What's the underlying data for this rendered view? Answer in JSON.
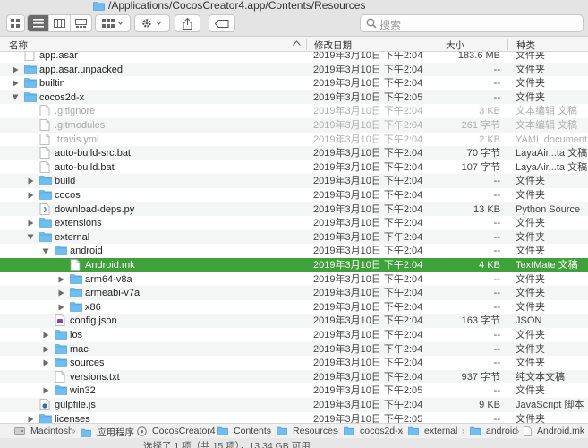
{
  "window": {
    "title": "/Applications/CocosCreator4.app/Contents/Resources"
  },
  "search": {
    "placeholder": "搜索"
  },
  "columns": {
    "name": "名称",
    "date": "修改日期",
    "size": "大小",
    "kind": "种类"
  },
  "rows": [
    {
      "name": "app.asar",
      "date": "2019年3月10日 下午2:04",
      "size": "183.6 MB",
      "kind": "文件夹",
      "icon": "file-icon",
      "depth": 1,
      "expander": "none",
      "dim": false
    },
    {
      "name": "app.asar.unpacked",
      "date": "2019年3月10日 下午2:04",
      "size": "--",
      "kind": "文件夹",
      "icon": "folder-icon",
      "depth": 1,
      "expander": "collapsed",
      "dim": false
    },
    {
      "name": "builtin",
      "date": "2019年3月10日 下午2:04",
      "size": "--",
      "kind": "文件夹",
      "icon": "folder-icon",
      "depth": 1,
      "expander": "collapsed",
      "dim": false
    },
    {
      "name": "cocos2d-x",
      "date": "2019年3月10日 下午2:05",
      "size": "--",
      "kind": "文件夹",
      "icon": "folder-icon",
      "depth": 1,
      "expander": "expanded",
      "dim": false
    },
    {
      "name": ".gitignore",
      "date": "2019年3月10日 下午2:04",
      "size": "3 KB",
      "kind": "文本编辑 文稿",
      "icon": "document-icon",
      "depth": 2,
      "expander": "none",
      "dim": true
    },
    {
      "name": ".gitmodules",
      "date": "2019年3月10日 下午2:04",
      "size": "261 字节",
      "kind": "文本编辑 文稿",
      "icon": "document-icon",
      "depth": 2,
      "expander": "none",
      "dim": true
    },
    {
      "name": ".travis.yml",
      "date": "2019年3月10日 下午2:04",
      "size": "2 KB",
      "kind": "YAML document",
      "icon": "document-icon",
      "depth": 2,
      "expander": "none",
      "dim": true
    },
    {
      "name": "auto-build-src.bat",
      "date": "2019年3月10日 下午2:04",
      "size": "70 字节",
      "kind": "LayaAir...ta 文稿",
      "icon": "document-icon",
      "depth": 2,
      "expander": "none",
      "dim": false
    },
    {
      "name": "auto-build.bat",
      "date": "2019年3月10日 下午2:04",
      "size": "107 字节",
      "kind": "LayaAir...ta 文稿",
      "icon": "document-icon",
      "depth": 2,
      "expander": "none",
      "dim": false
    },
    {
      "name": "build",
      "date": "2019年3月10日 下午2:04",
      "size": "--",
      "kind": "文件夹",
      "icon": "folder-icon",
      "depth": 2,
      "expander": "collapsed",
      "dim": false
    },
    {
      "name": "cocos",
      "date": "2019年3月10日 下午2:04",
      "size": "--",
      "kind": "文件夹",
      "icon": "folder-icon",
      "depth": 2,
      "expander": "collapsed",
      "dim": false
    },
    {
      "name": "download-deps.py",
      "date": "2019年3月10日 下午2:04",
      "size": "13 KB",
      "kind": "Python Source",
      "icon": "python-file-icon",
      "depth": 2,
      "expander": "none",
      "dim": false
    },
    {
      "name": "extensions",
      "date": "2019年3月10日 下午2:04",
      "size": "--",
      "kind": "文件夹",
      "icon": "folder-icon",
      "depth": 2,
      "expander": "collapsed",
      "dim": false
    },
    {
      "name": "external",
      "date": "2019年3月10日 下午2:04",
      "size": "--",
      "kind": "文件夹",
      "icon": "folder-icon",
      "depth": 2,
      "expander": "expanded",
      "dim": false
    },
    {
      "name": "android",
      "date": "2019年3月10日 下午2:04",
      "size": "--",
      "kind": "文件夹",
      "icon": "folder-icon",
      "depth": 3,
      "expander": "expanded",
      "dim": false
    },
    {
      "name": "Android.mk",
      "date": "2019年3月10日 下午2:04",
      "size": "4 KB",
      "kind": "TextMate 文稿",
      "icon": "document-icon",
      "depth": 4,
      "expander": "none",
      "dim": false,
      "selected": true
    },
    {
      "name": "arm64-v8a",
      "date": "2019年3月10日 下午2:04",
      "size": "--",
      "kind": "文件夹",
      "icon": "folder-icon",
      "depth": 4,
      "expander": "collapsed",
      "dim": false
    },
    {
      "name": "armeabi-v7a",
      "date": "2019年3月10日 下午2:04",
      "size": "--",
      "kind": "文件夹",
      "icon": "folder-icon",
      "depth": 4,
      "expander": "collapsed",
      "dim": false
    },
    {
      "name": "x86",
      "date": "2019年3月10日 下午2:04",
      "size": "--",
      "kind": "文件夹",
      "icon": "folder-icon",
      "depth": 4,
      "expander": "collapsed",
      "dim": false
    },
    {
      "name": "config.json",
      "date": "2019年3月10日 下午2:04",
      "size": "163 字节",
      "kind": "JSON",
      "icon": "json-file-icon",
      "depth": 3,
      "expander": "none",
      "dim": false
    },
    {
      "name": "ios",
      "date": "2019年3月10日 下午2:04",
      "size": "--",
      "kind": "文件夹",
      "icon": "folder-icon",
      "depth": 3,
      "expander": "collapsed",
      "dim": false
    },
    {
      "name": "mac",
      "date": "2019年3月10日 下午2:04",
      "size": "--",
      "kind": "文件夹",
      "icon": "folder-icon",
      "depth": 3,
      "expander": "collapsed",
      "dim": false
    },
    {
      "name": "sources",
      "date": "2019年3月10日 下午2:04",
      "size": "--",
      "kind": "文件夹",
      "icon": "folder-icon",
      "depth": 3,
      "expander": "collapsed",
      "dim": false
    },
    {
      "name": "versions.txt",
      "date": "2019年3月10日 下午2:04",
      "size": "937 字节",
      "kind": "纯文本文稿",
      "icon": "document-icon",
      "depth": 3,
      "expander": "none",
      "dim": false
    },
    {
      "name": "win32",
      "date": "2019年3月10日 下午2:05",
      "size": "--",
      "kind": "文件夹",
      "icon": "folder-icon",
      "depth": 3,
      "expander": "collapsed",
      "dim": false
    },
    {
      "name": "gulpfile.js",
      "date": "2019年3月10日 下午2:04",
      "size": "9 KB",
      "kind": "JavaScript 脚本",
      "icon": "js-file-icon",
      "depth": 2,
      "expander": "none",
      "dim": false
    },
    {
      "name": "licenses",
      "date": "2019年3月10日 下午2:05",
      "size": "--",
      "kind": "文件夹",
      "icon": "folder-icon",
      "depth": 2,
      "expander": "collapsed",
      "dim": false
    }
  ],
  "pathbar": {
    "items": [
      {
        "label": "Macintosh",
        "icon": "disk-icon"
      },
      {
        "label": "应用程序",
        "icon": "folder-icon"
      },
      {
        "label": "CocosCreator4",
        "icon": "app-icon"
      },
      {
        "label": "Contents",
        "icon": "folder-icon"
      },
      {
        "label": "Resources",
        "icon": "folder-icon"
      },
      {
        "label": "cocos2d-x",
        "icon": "folder-icon"
      },
      {
        "label": "external",
        "icon": "folder-icon"
      },
      {
        "label": "android",
        "icon": "folder-icon"
      },
      {
        "label": "Android.mk",
        "icon": "document-icon"
      }
    ],
    "separator": "›"
  },
  "status": {
    "text": "选择了 1 项（共 15 项），13.34 GB 可用"
  },
  "colors": {
    "selection": "#3fa13a",
    "folder": "#5fb5ec",
    "stripe": "#f4f5f5"
  }
}
